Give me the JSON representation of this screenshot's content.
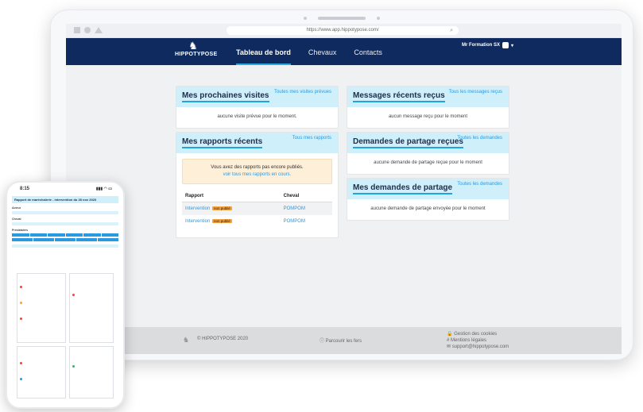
{
  "browser": {
    "url": "https://www.app.hippotypose.com/"
  },
  "appbar": {
    "logo_text": "HIPPOTYPOSE",
    "nav": [
      "Tableau de bord",
      "Chevaux",
      "Contacts"
    ],
    "user": "Mr Formation SX"
  },
  "visits": {
    "title": "Mes prochaines visites",
    "link": "Toutes mes visites prévues",
    "empty": "aucune visite prévue pour le moment."
  },
  "messages": {
    "title": "Messages récents reçus",
    "link": "Tous les messages reçus",
    "empty": "aucun message reçu pour le moment"
  },
  "reports": {
    "title": "Mes rapports récents",
    "link": "Tous mes rapports",
    "notice_line1": "Vous avez des rapports pas encore publiés.",
    "notice_line2": "voir tous mes rapports en cours.",
    "col_report": "Rapport",
    "col_horse": "Cheval",
    "rows": [
      {
        "report": "Intervention",
        "badge": "non publié",
        "horse": "POMPOM"
      },
      {
        "report": "Intervention",
        "badge": "non publié",
        "horse": "POMPOM"
      }
    ]
  },
  "share_received": {
    "title": "Demandes de partage reçues",
    "link": "Toutes les demandes",
    "empty": "aucune demande de partage reçue pour le moment"
  },
  "share_sent": {
    "title": "Mes demandes de partage",
    "link": "Toutes les demandes",
    "empty": "aucune demande de partage envoyée pour le moment"
  },
  "footer": {
    "copyright": "© HIPPOTYPOSE 2020",
    "mid": "Parcourir les fers",
    "cookies": "Gestion des cookies",
    "legal": "Mentions légales",
    "email": "support@hippotypose.com"
  },
  "phone": {
    "time": "8:15",
    "title": "Rapport de maréchalerie - intervention du 28 nov 2023",
    "actors": "Acteur",
    "horse": "Cheval",
    "providers": "Prestataires"
  }
}
